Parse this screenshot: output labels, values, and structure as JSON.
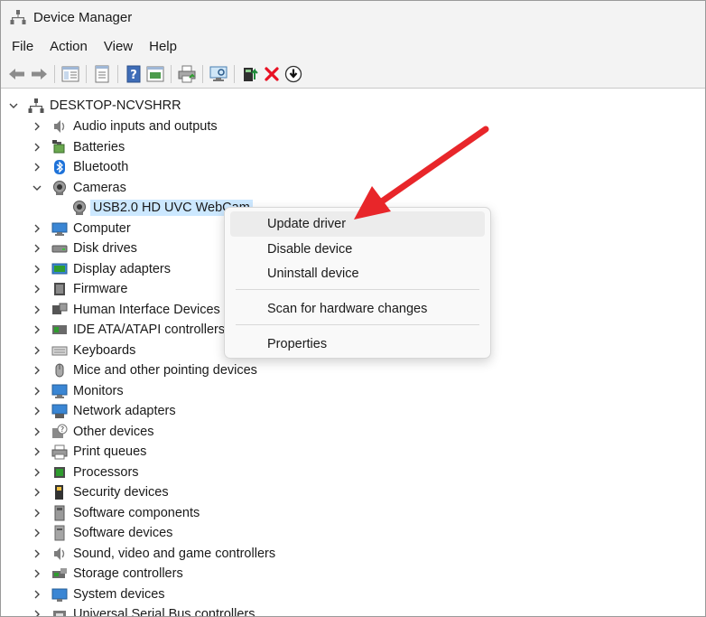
{
  "window": {
    "title": "Device Manager"
  },
  "menu": [
    "File",
    "Action",
    "View",
    "Help"
  ],
  "toolbar": {
    "icons": [
      "back-arrow-icon",
      "forward-arrow-icon",
      "properties-pane-icon",
      "properties-icon",
      "help-icon",
      "show-hidden-icon",
      "print-icon",
      "scan-monitor-icon",
      "update-driver-icon",
      "uninstall-icon",
      "install-icon"
    ]
  },
  "tree": {
    "root": "DESKTOP-NCVSHRR",
    "items": [
      {
        "label": "Audio inputs and outputs",
        "icon": "speaker-icon"
      },
      {
        "label": "Batteries",
        "icon": "battery-icon"
      },
      {
        "label": "Bluetooth",
        "icon": "bluetooth-icon"
      },
      {
        "label": "Cameras",
        "icon": "camera-icon",
        "expanded": true
      },
      {
        "label": "USB2.0 HD UVC WebCam",
        "icon": "webcam-icon",
        "child": true
      },
      {
        "label": "Computer",
        "icon": "computer-icon"
      },
      {
        "label": "Disk drives",
        "icon": "disk-icon"
      },
      {
        "label": "Display adapters",
        "icon": "display-adapter-icon"
      },
      {
        "label": "Firmware",
        "icon": "firmware-icon"
      },
      {
        "label": "Human Interface Devices",
        "icon": "hid-icon"
      },
      {
        "label": "IDE ATA/ATAPI controllers",
        "icon": "ide-icon"
      },
      {
        "label": "Keyboards",
        "icon": "keyboard-icon"
      },
      {
        "label": "Mice and other pointing devices",
        "icon": "mouse-icon"
      },
      {
        "label": "Monitors",
        "icon": "monitor-icon"
      },
      {
        "label": "Network adapters",
        "icon": "network-icon"
      },
      {
        "label": "Other devices",
        "icon": "other-devices-icon"
      },
      {
        "label": "Print queues",
        "icon": "printer-icon"
      },
      {
        "label": "Processors",
        "icon": "processor-icon"
      },
      {
        "label": "Security devices",
        "icon": "security-icon"
      },
      {
        "label": "Software components",
        "icon": "software-component-icon"
      },
      {
        "label": "Software devices",
        "icon": "software-device-icon"
      },
      {
        "label": "Sound, video and game controllers",
        "icon": "sound-icon"
      },
      {
        "label": "Storage controllers",
        "icon": "storage-icon"
      },
      {
        "label": "System devices",
        "icon": "system-icon"
      },
      {
        "label": "Universal Serial Bus controllers",
        "icon": "usb-icon"
      }
    ]
  },
  "context_menu": {
    "items": [
      "Update driver",
      "Disable device",
      "Uninstall device",
      "Scan for hardware changes",
      "Properties"
    ]
  },
  "colors": {
    "selection": "#cce8ff",
    "annotation_arrow": "#e8262a",
    "uninstall_red": "#e81123",
    "install_green": "#1e8a3a"
  }
}
